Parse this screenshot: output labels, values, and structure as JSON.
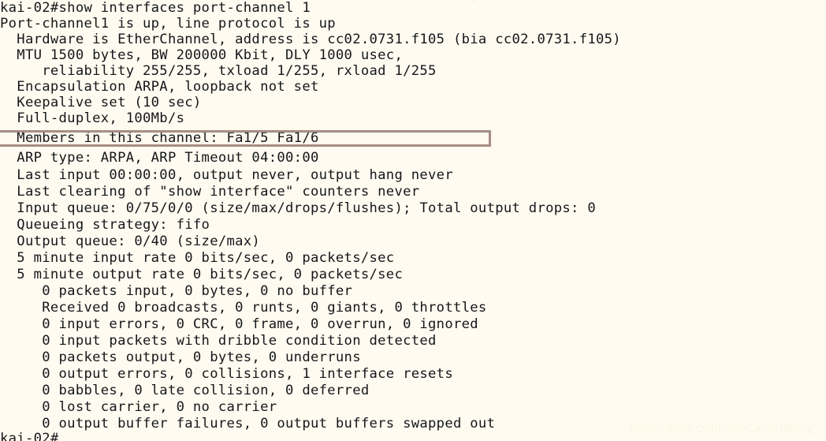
{
  "terminal": {
    "background_color": "#fffbf0",
    "text_color": "#15161a",
    "prompt": "kai-02#",
    "command": "show interfaces port-channel 1",
    "lines": [
      {
        "id": "cmd",
        "text": "kai-02#show interfaces port-channel 1"
      },
      {
        "id": "iface-status",
        "text": "Port-channel1 is up, line protocol is up"
      },
      {
        "id": "hardware",
        "text": "  Hardware is EtherChannel, address is cc02.0731.f105 (bia cc02.0731.f105)"
      },
      {
        "id": "mtu",
        "text": "  MTU 1500 bytes, BW 200000 Kbit, DLY 1000 usec,"
      },
      {
        "id": "reliability",
        "text": "     reliability 255/255, txload 1/255, rxload 1/255"
      },
      {
        "id": "encapsulation",
        "text": "  Encapsulation ARPA, loopback not set"
      },
      {
        "id": "keepalive",
        "text": "  Keepalive set (10 sec)"
      },
      {
        "id": "duplex",
        "text": "  Full-duplex, 100Mb/s"
      },
      {
        "id": "members",
        "text": "  Members in this channel: Fa1/5 Fa1/6"
      },
      {
        "id": "arp-type",
        "text": "  ARP type: ARPA, ARP Timeout 04:00:00"
      },
      {
        "id": "last-input",
        "text": "  Last input 00:00:00, output never, output hang never"
      },
      {
        "id": "last-clearing",
        "text": "  Last clearing of \"show interface\" counters never"
      },
      {
        "id": "input-queue",
        "text": "  Input queue: 0/75/0/0 (size/max/drops/flushes); Total output drops: 0"
      },
      {
        "id": "queue-strategy",
        "text": "  Queueing strategy: fifo"
      },
      {
        "id": "output-queue",
        "text": "  Output queue: 0/40 (size/max)"
      },
      {
        "id": "input-rate",
        "text": "  5 minute input rate 0 bits/sec, 0 packets/sec"
      },
      {
        "id": "output-rate",
        "text": "  5 minute output rate 0 bits/sec, 0 packets/sec"
      },
      {
        "id": "packets-input",
        "text": "     0 packets input, 0 bytes, 0 no buffer"
      },
      {
        "id": "received",
        "text": "     Received 0 broadcasts, 0 runts, 0 giants, 0 throttles"
      },
      {
        "id": "input-errors",
        "text": "     0 input errors, 0 CRC, 0 frame, 0 overrun, 0 ignored"
      },
      {
        "id": "dribble",
        "text": "     0 input packets with dribble condition detected"
      },
      {
        "id": "packets-output",
        "text": "     0 packets output, 0 bytes, 0 underruns"
      },
      {
        "id": "output-errors",
        "text": "     0 output errors, 0 collisions, 1 interface resets"
      },
      {
        "id": "babbles",
        "text": "     0 babbles, 0 late collision, 0 deferred"
      },
      {
        "id": "lost-carrier",
        "text": "     0 lost carrier, 0 no carrier"
      },
      {
        "id": "buffer-failures",
        "text": "     0 output buffer failures, 0 output buffers swapped out"
      },
      {
        "id": "final-prompt",
        "text": "kai-02#"
      }
    ]
  },
  "annotation": {
    "highlight_box": {
      "target_line_id": "members",
      "target_text": "Members in this channel: Fa1/5 Fa1/6",
      "border_color": "#a68d85"
    }
  },
  "watermark": {
    "text": "https://blog.csdn.net/CactusStory_",
    "color": "#fdf4e2"
  }
}
